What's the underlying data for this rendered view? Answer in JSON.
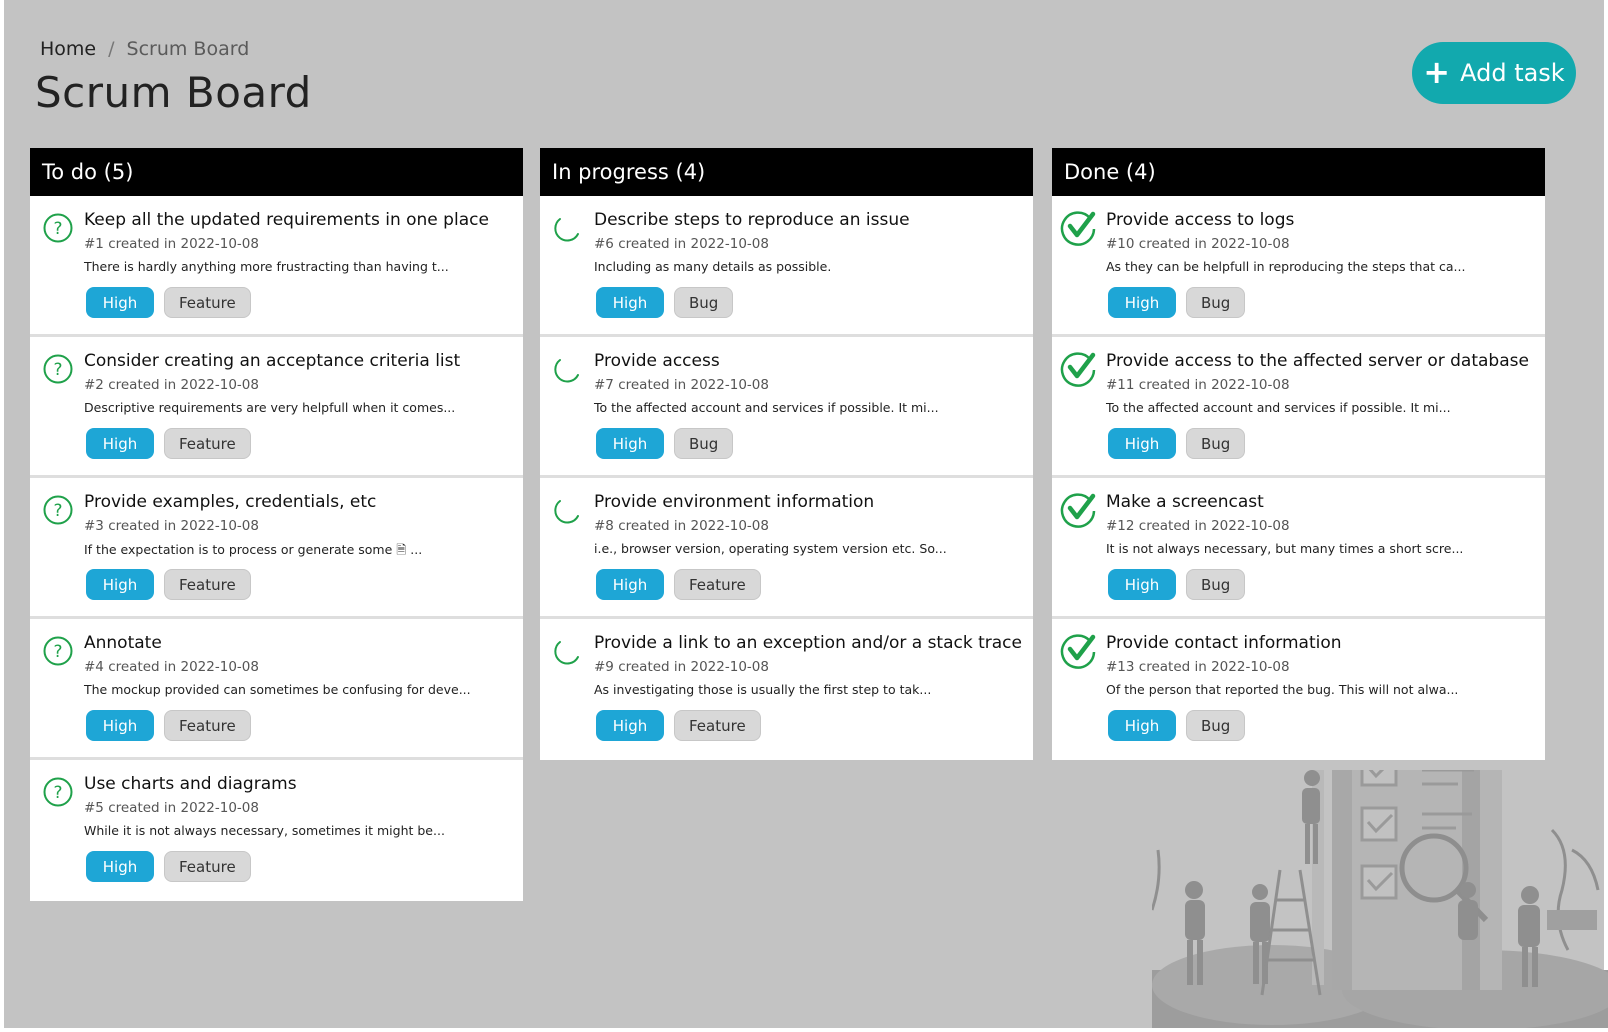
{
  "breadcrumb": {
    "home": "Home",
    "separator": "/",
    "current": "Scrum Board"
  },
  "page_title": "Scrum Board",
  "add_button": {
    "icon": "plus-icon",
    "label": "Add task"
  },
  "colors": {
    "accent": "#12a9ae",
    "priority_high": "#1ea6d6",
    "status_green": "#1fa14a",
    "header_bg": "#000000",
    "page_bg": "#c3c3c3"
  },
  "columns": [
    {
      "title": "To do (5)",
      "status_icon": "question-circle-icon",
      "cards": [
        {
          "title": "Keep all the updated requirements in one place",
          "meta": "#1 created in 2022-10-08",
          "desc": "There is hardly anything more frustracting than having t...",
          "priority": "High",
          "type": "Feature"
        },
        {
          "title": "Consider creating an acceptance criteria list",
          "meta": "#2 created in 2022-10-08",
          "desc": "Descriptive requirements are very helpfull when it comes...",
          "priority": "High",
          "type": "Feature"
        },
        {
          "title": "Provide examples, credentials, etc",
          "meta": "#3 created in 2022-10-08",
          "desc": "If the expectation is to process or generate some 🗎 ...",
          "priority": "High",
          "type": "Feature"
        },
        {
          "title": "Annotate",
          "meta": "#4 created in 2022-10-08",
          "desc": "The mockup provided can sometimes be confusing for deve...",
          "priority": "High",
          "type": "Feature"
        },
        {
          "title": "Use charts and diagrams",
          "meta": "#5 created in 2022-10-08",
          "desc": "While it is not always necessary, sometimes it might be...",
          "priority": "High",
          "type": "Feature"
        }
      ]
    },
    {
      "title": "In progress (4)",
      "status_icon": "spinner-icon",
      "cards": [
        {
          "title": "Describe steps to reproduce an issue",
          "meta": "#6 created in 2022-10-08",
          "desc": "Including as many details as possible.",
          "priority": "High",
          "type": "Bug"
        },
        {
          "title": "Provide access",
          "meta": "#7 created in 2022-10-08",
          "desc": "To the affected account and services if possible. It mi...",
          "priority": "High",
          "type": "Bug"
        },
        {
          "title": "Provide environment information",
          "meta": "#8 created in 2022-10-08",
          "desc": "i.e., browser version, operating system version etc. So...",
          "priority": "High",
          "type": "Feature"
        },
        {
          "title": "Provide a link to an exception and/or a stack trace",
          "meta": "#9 created in 2022-10-08",
          "desc": "As investigating those is usually the first step to tak...",
          "priority": "High",
          "type": "Feature"
        }
      ]
    },
    {
      "title": "Done (4)",
      "status_icon": "check-circle-icon",
      "cards": [
        {
          "title": "Provide access to logs",
          "meta": "#10 created in 2022-10-08",
          "desc": "As they can be helpfull in reproducing the steps that ca...",
          "priority": "High",
          "type": "Bug"
        },
        {
          "title": "Provide access to the affected server or database",
          "meta": "#11 created in 2022-10-08",
          "desc": "To the affected account and services if possible. It mi...",
          "priority": "High",
          "type": "Bug"
        },
        {
          "title": "Make a screencast",
          "meta": "#12 created in 2022-10-08",
          "desc": "It is not always necessary, but many times a short scre...",
          "priority": "High",
          "type": "Bug"
        },
        {
          "title": "Provide contact information",
          "meta": "#13 created in 2022-10-08",
          "desc": "Of the person that reported the bug. This will not alwa...",
          "priority": "High",
          "type": "Bug"
        }
      ]
    }
  ]
}
